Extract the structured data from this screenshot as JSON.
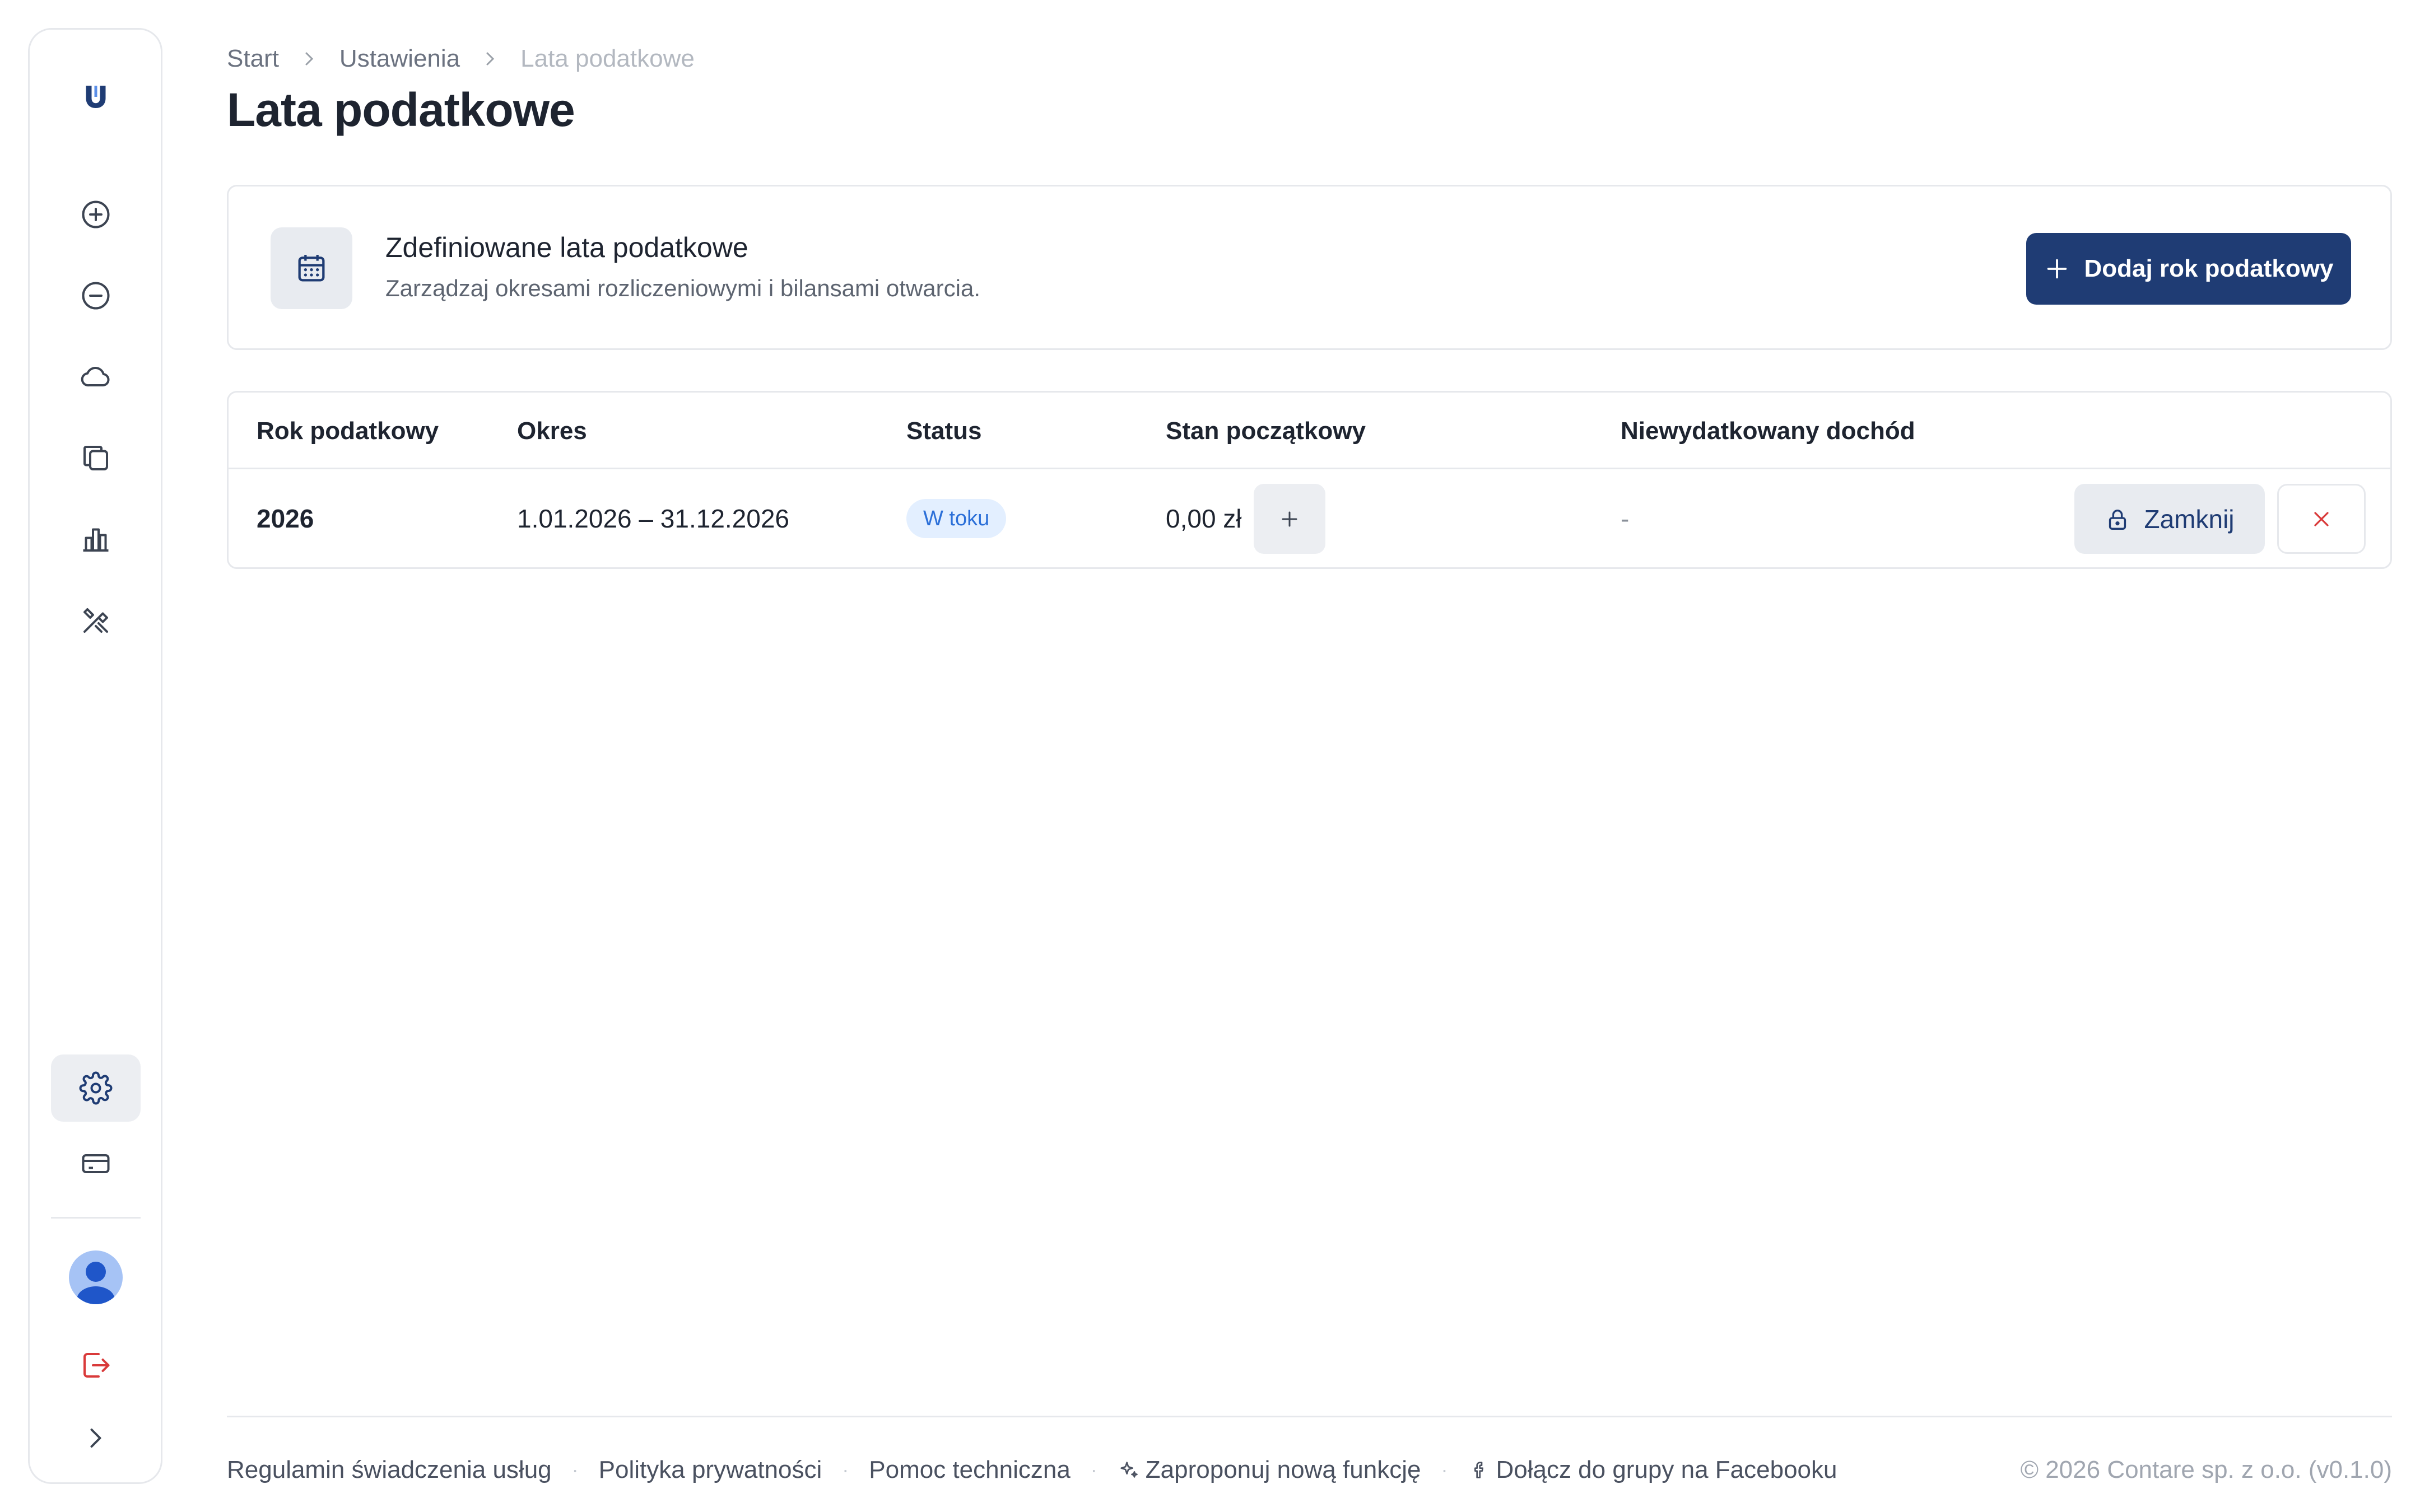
{
  "breadcrumb": {
    "items": [
      "Start",
      "Ustawienia",
      "Lata podatkowe"
    ]
  },
  "page": {
    "title": "Lata podatkowe"
  },
  "card": {
    "title": "Zdefiniowane lata podatkowe",
    "subtitle": "Zarządzaj okresami rozliczeniowymi i bilansami otwarcia.",
    "add_button": "Dodaj rok podatkowy"
  },
  "table": {
    "headers": [
      "Rok podatkowy",
      "Okres",
      "Status",
      "Stan początkowy",
      "Niewydatkowany dochód"
    ],
    "rows": [
      {
        "year": "2026",
        "period": "1.01.2026 – 31.12.2026",
        "status": "W toku",
        "opening_balance": "0,00 zł",
        "unspent_income": "-",
        "close_label": "Zamknij"
      }
    ]
  },
  "footer": {
    "links": [
      "Regulamin świadczenia usług",
      "Polityka prywatności",
      "Pomoc techniczna",
      "Zaproponuj nową funkcję",
      "Dołącz do grupy na Facebooku"
    ],
    "copyright": "© 2026 Contare sp. z o.o. (v0.1.0)"
  },
  "colors": {
    "primary": "#1f3c74",
    "danger": "#d93a3a",
    "status_bg": "#e3efff",
    "status_text": "#2b6fd8"
  },
  "icons": {
    "sidebar": [
      "logo-icon",
      "plus-circle-icon",
      "minus-circle-icon",
      "cloud-icon",
      "documents-icon",
      "bar-chart-icon",
      "tools-icon",
      "gear-icon",
      "card-icon",
      "avatar",
      "logout-icon",
      "chevron-right-icon"
    ]
  }
}
